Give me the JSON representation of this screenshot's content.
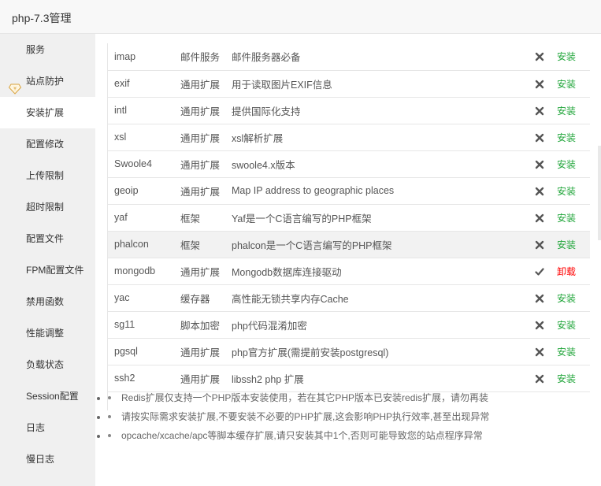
{
  "window": {
    "title": "php-7.3管理"
  },
  "sidebar": {
    "items": [
      {
        "label": "服务"
      },
      {
        "label": "站点防护",
        "icon": "gem-icon"
      },
      {
        "label": "安装扩展",
        "active": true
      },
      {
        "label": "配置修改"
      },
      {
        "label": "上传限制"
      },
      {
        "label": "超时限制"
      },
      {
        "label": "配置文件"
      },
      {
        "label": "FPM配置文件"
      },
      {
        "label": "禁用函数"
      },
      {
        "label": "性能调整"
      },
      {
        "label": "负载状态"
      },
      {
        "label": "Session配置"
      },
      {
        "label": "日志"
      },
      {
        "label": "慢日志"
      }
    ]
  },
  "extensions": [
    {
      "name": "imap",
      "type": "邮件服务",
      "desc": "邮件服务器必备",
      "installed": false,
      "action": "安装"
    },
    {
      "name": "exif",
      "type": "通用扩展",
      "desc": "用于读取图片EXIF信息",
      "installed": false,
      "action": "安装"
    },
    {
      "name": "intl",
      "type": "通用扩展",
      "desc": "提供国际化支持",
      "installed": false,
      "action": "安装"
    },
    {
      "name": "xsl",
      "type": "通用扩展",
      "desc": "xsl解析扩展",
      "installed": false,
      "action": "安装"
    },
    {
      "name": "Swoole4",
      "type": "通用扩展",
      "desc": "swoole4.x版本",
      "installed": false,
      "action": "安装"
    },
    {
      "name": "geoip",
      "type": "通用扩展",
      "desc": "Map IP address to geographic places",
      "installed": false,
      "action": "安装"
    },
    {
      "name": "yaf",
      "type": "框架",
      "desc": "Yaf是一个C语言编写的PHP框架",
      "installed": false,
      "action": "安装"
    },
    {
      "name": "phalcon",
      "type": "框架",
      "desc": "phalcon是一个C语言编写的PHP框架",
      "installed": false,
      "action": "安装",
      "hover": true
    },
    {
      "name": "mongodb",
      "type": "通用扩展",
      "desc": "Mongodb数据库连接驱动",
      "installed": true,
      "action": "卸载"
    },
    {
      "name": "yac",
      "type": "缓存器",
      "desc": "高性能无锁共享内存Cache",
      "installed": false,
      "action": "安装"
    },
    {
      "name": "sg11",
      "type": "脚本加密",
      "desc": "php代码混淆加密",
      "installed": false,
      "action": "安装"
    },
    {
      "name": "pgsql",
      "type": "通用扩展",
      "desc": "php官方扩展(需提前安装postgresql)",
      "installed": false,
      "action": "安装"
    },
    {
      "name": "ssh2",
      "type": "通用扩展",
      "desc": "libssh2 php 扩展",
      "installed": false,
      "action": "安装"
    }
  ],
  "notes": [
    "Redis扩展仅支持一个PHP版本安装使用，若在其它PHP版本已安装redis扩展，请勿再装",
    "请按实际需求安装扩展,不要安装不必要的PHP扩展,这会影响PHP执行效率,甚至出现异常",
    "opcache/xcache/apc等脚本缓存扩展,请只安装其中1个,否则可能导致您的站点程序异常"
  ],
  "colors": {
    "install": "#20a53a",
    "uninstall": "#ff0000",
    "sidebar_bg": "#f0f0f0"
  }
}
